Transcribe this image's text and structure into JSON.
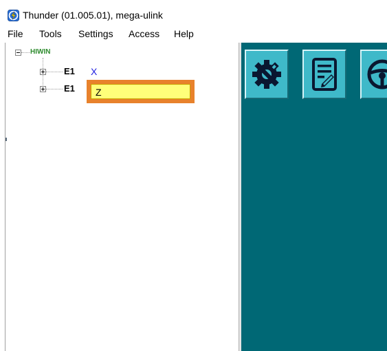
{
  "window": {
    "title": "Thunder (01.005.01), mega-ulink",
    "icon": "thunder-app-icon"
  },
  "menu": [
    {
      "label": "File"
    },
    {
      "label": "Tools"
    },
    {
      "label": "Settings"
    },
    {
      "label": "Access"
    },
    {
      "label": "Help"
    }
  ],
  "tree": {
    "root": {
      "label": "HIWIN",
      "expanded": true
    },
    "children": [
      {
        "label": "E1",
        "axis": "X",
        "expanded": false
      },
      {
        "label": "E1",
        "axis_value": "Z",
        "expanded": false,
        "editing": true
      }
    ]
  },
  "toolbar": {
    "buttons": [
      {
        "icon": "gear-wrench-icon"
      },
      {
        "icon": "notepad-icon"
      },
      {
        "icon": "steering-wheel-icon"
      }
    ]
  },
  "colors": {
    "workspace": "#006875",
    "button_face": "#3fb9c9",
    "edit_highlight": "#e8822c",
    "edit_field": "#ffff7a",
    "root_label": "#2e8b2e",
    "axis_label": "#1f1fe0"
  }
}
